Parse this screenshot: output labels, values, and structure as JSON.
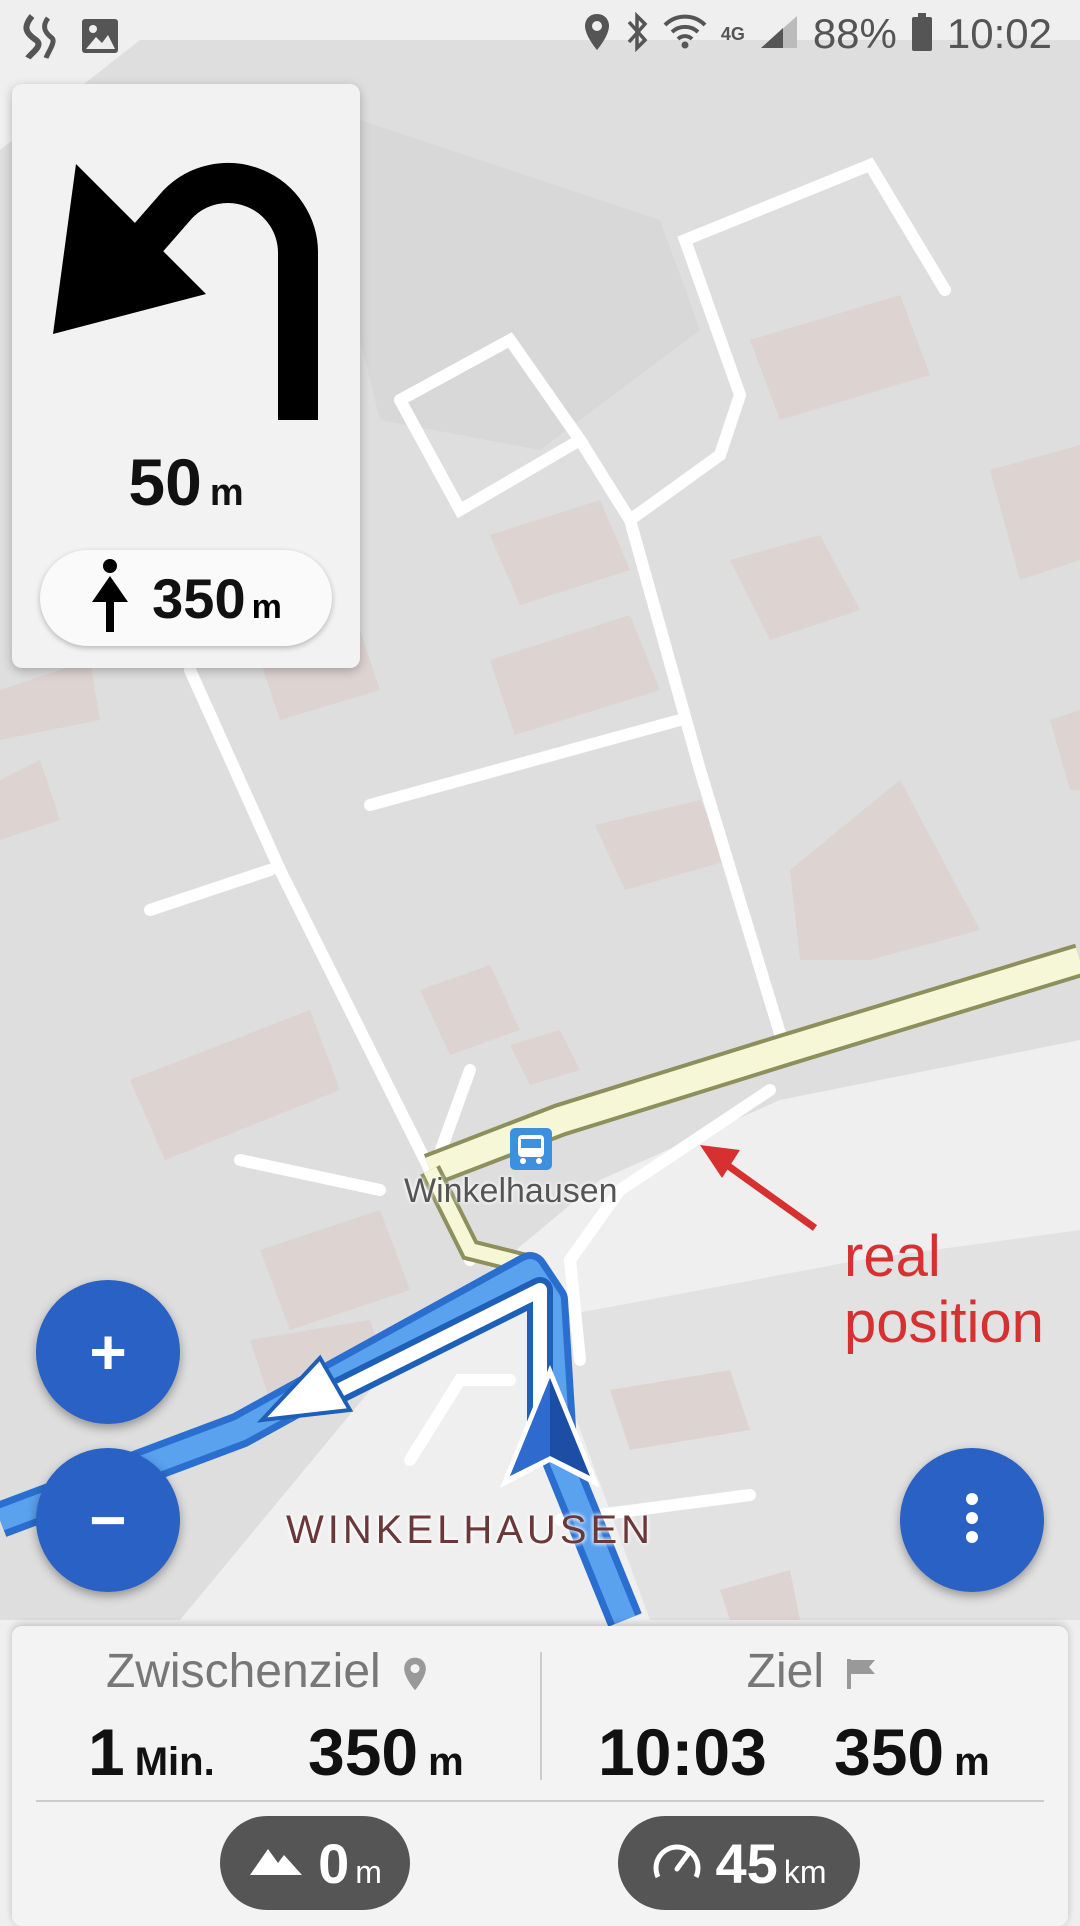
{
  "status_bar": {
    "battery": "88%",
    "time": "10:02",
    "network": "4G"
  },
  "nav_card": {
    "turn_distance": "50",
    "turn_distance_unit": "m",
    "next_distance": "350",
    "next_distance_unit": "m"
  },
  "map": {
    "place_label": "Winkelhausen",
    "town_label": "WINKELHAUSEN",
    "annotation_line1": "real",
    "annotation_line2": "position",
    "annotation_color": "#d63030",
    "route_color": "#4a90e2"
  },
  "bottom": {
    "waypoint_title": "Zwischenziel",
    "waypoint_time": "1",
    "waypoint_time_unit": "Min.",
    "waypoint_distance": "350",
    "waypoint_distance_unit": "m",
    "dest_title": "Ziel",
    "dest_time": "10:03",
    "dest_distance": "350",
    "dest_distance_unit": "m",
    "altitude": "0",
    "altitude_unit": "m",
    "speed": "45",
    "speed_unit": "km"
  },
  "buttons": {
    "zoom_in": "+",
    "zoom_out": "−"
  },
  "colors": {
    "fab": "#2962c4",
    "chip": "#555555"
  }
}
